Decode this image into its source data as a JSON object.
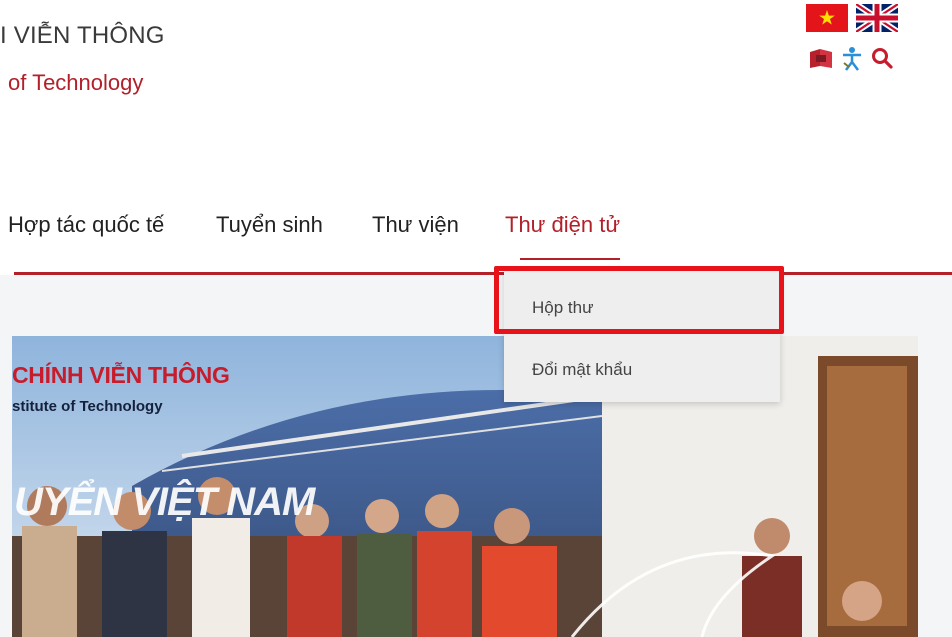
{
  "header": {
    "title_vn": "I VIỄN THÔNG",
    "title_en": "of Technology",
    "lang_vi_icon": "vietnam-flag-icon",
    "lang_en_icon": "uk-flag-icon",
    "tools": [
      "book-icon",
      "accessibility-icon",
      "search-icon"
    ]
  },
  "nav": {
    "items": [
      {
        "label": "Hợp tác quốc tế"
      },
      {
        "label": "Tuyển sinh"
      },
      {
        "label": "Thư viện"
      },
      {
        "label": "Thư điện tử"
      }
    ],
    "active_index": 3
  },
  "dropdown": {
    "items": [
      {
        "label": "Hộp thư"
      },
      {
        "label": "Đổi mật khẩu"
      }
    ]
  },
  "banner": {
    "line1": "CHÍNH VIỄN THÔNG",
    "line2": "stitute of Technology",
    "line3": "UYỂN VIỆT NAM"
  },
  "colors": {
    "accent": "#b3202a",
    "highlight_box": "#e8121a"
  }
}
